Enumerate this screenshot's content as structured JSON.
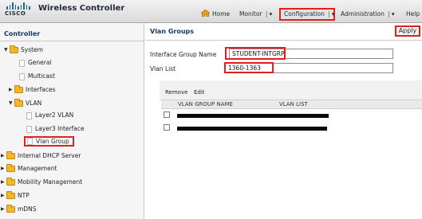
{
  "header": {
    "logo_text": "CISCO",
    "app_title": "Wireless Controller",
    "nav": {
      "home": "Home",
      "monitor": "Monitor",
      "configuration": "Configuration",
      "administration": "Administration",
      "help": "Help",
      "dropdown_separator": "|",
      "dropdown_arrow": "▾"
    }
  },
  "sidebar": {
    "title": "Controller",
    "items": [
      {
        "label": "System",
        "type": "folder",
        "expanded": true
      },
      {
        "label": "General",
        "type": "page"
      },
      {
        "label": "Multicast",
        "type": "page"
      },
      {
        "label": "Interfaces",
        "type": "folder",
        "expanded": false
      },
      {
        "label": "VLAN",
        "type": "folder",
        "expanded": true
      },
      {
        "label": "Layer2 VLAN",
        "type": "page"
      },
      {
        "label": "Layer3 Interface",
        "type": "page"
      },
      {
        "label": "Vlan Group",
        "type": "page",
        "selected": true
      },
      {
        "label": "Internal DHCP Server",
        "type": "folder",
        "expanded": false
      },
      {
        "label": "Management",
        "type": "folder",
        "expanded": false
      },
      {
        "label": "Mobility Management",
        "type": "folder",
        "expanded": false
      },
      {
        "label": "NTP",
        "type": "folder",
        "expanded": false
      },
      {
        "label": "mDNS",
        "type": "folder",
        "expanded": false
      }
    ],
    "expanded_arrow": "▼",
    "collapsed_arrow": "▶"
  },
  "main": {
    "title": "Vlan Groups",
    "apply_label": "Apply",
    "form": {
      "group_name_label": "Interface Group Name",
      "group_name_value": "STUDENT-INTGRP",
      "vlan_list_label": "Vlan List",
      "vlan_list_value": "1360-1363"
    },
    "toolbar": {
      "remove_label": "Remove",
      "edit_label": "Edit"
    },
    "table": {
      "columns": [
        "VLAN GROUP NAME",
        "VLAN LIST"
      ],
      "rows": [
        {
          "redacted": true
        },
        {
          "redacted": true
        }
      ]
    }
  },
  "colors": {
    "highlight": "#e02020",
    "heading": "#1a3a63",
    "folder": "#f2b632"
  }
}
